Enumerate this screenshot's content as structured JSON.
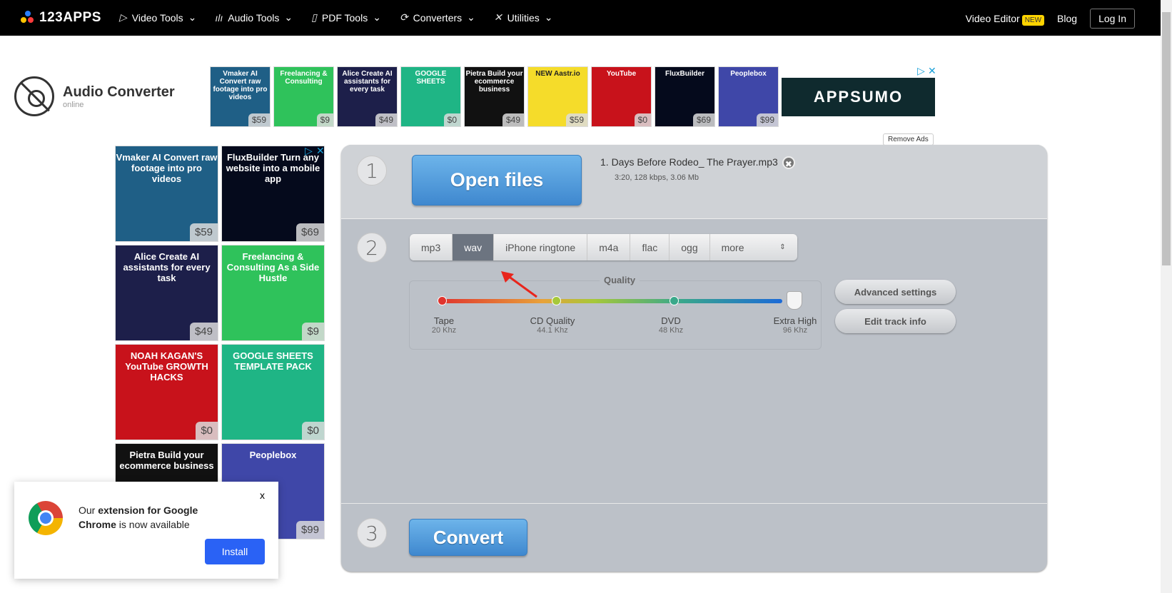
{
  "header": {
    "logo": "123APPS",
    "nav": [
      {
        "label": "Video Tools",
        "icon": "play-icon"
      },
      {
        "label": "Audio Tools",
        "icon": "waveform-icon"
      },
      {
        "label": "PDF Tools",
        "icon": "document-icon"
      },
      {
        "label": "Converters",
        "icon": "refresh-icon"
      },
      {
        "label": "Utilities",
        "icon": "tools-icon"
      }
    ],
    "video_editor": "Video Editor",
    "new_badge": "NEW",
    "blog": "Blog",
    "login": "Log In"
  },
  "brand": {
    "title": "Audio Converter",
    "subtitle": "online"
  },
  "top_ads": [
    {
      "text": "Vmaker AI Convert raw footage into pro videos",
      "price": "$59",
      "color": "#1f5f86"
    },
    {
      "text": "Freelancing & Consulting",
      "price": "$9",
      "color": "#2fc25b"
    },
    {
      "text": "Alice Create AI assistants for every task",
      "price": "$49",
      "color": "#1d1f4a"
    },
    {
      "text": "GOOGLE SHEETS",
      "price": "$0",
      "color": "#1fb585"
    },
    {
      "text": "Pietra Build your ecommerce business",
      "price": "$49",
      "color": "#111"
    },
    {
      "text": "NEW Aastr.io",
      "price": "$59",
      "color": "#f5dc2a"
    },
    {
      "text": "YouTube",
      "price": "$0",
      "color": "#c8121b"
    },
    {
      "text": "FluxBuilder",
      "price": "$69",
      "color": "#050a1c"
    },
    {
      "text": "Peoplebox",
      "price": "$99",
      "color": "#3f47a8"
    }
  ],
  "side_ads": [
    {
      "text": "Vmaker AI Convert raw footage into pro videos",
      "price": "$59",
      "color": "#1f5f86"
    },
    {
      "text": "FluxBuilder Turn any website into a mobile app",
      "price": "$69",
      "color": "#050a1c"
    },
    {
      "text": "Alice Create AI assistants for every task",
      "price": "$49",
      "color": "#1d1f4a"
    },
    {
      "text": "Freelancing & Consulting As a Side Hustle",
      "price": "$9",
      "color": "#2fc25b"
    },
    {
      "text": "NOAH KAGAN'S YouTube GROWTH HACKS",
      "price": "$0",
      "color": "#c8121b"
    },
    {
      "text": "GOOGLE SHEETS TEMPLATE PACK",
      "price": "$0",
      "color": "#1fb585"
    },
    {
      "text": "Pietra Build your ecommerce business",
      "price": "",
      "color": "#111"
    },
    {
      "text": "Peoplebox",
      "price": "$99",
      "color": "#3f47a8"
    }
  ],
  "appsumo": "APPSUMO",
  "remove_ads": "Remove Ads",
  "steps": {
    "one": "1",
    "two": "2",
    "three": "3"
  },
  "open_files": "Open files",
  "file": {
    "name": "1. Days Before Rodeo_ The Prayer.mp3",
    "meta": "3:20, 128 kbps, 3.06 Mb"
  },
  "formats": [
    "mp3",
    "wav",
    "iPhone ringtone",
    "m4a",
    "flac",
    "ogg"
  ],
  "more": "more",
  "selected_format": "wav",
  "quality": {
    "label": "Quality",
    "selected": "Extra High",
    "levels": [
      {
        "name": "Tape",
        "rate": "20 Khz"
      },
      {
        "name": "CD Quality",
        "rate": "44.1 Khz"
      },
      {
        "name": "DVD",
        "rate": "48 Khz"
      },
      {
        "name": "Extra High",
        "rate": "96 Khz"
      }
    ]
  },
  "advanced_settings": "Advanced settings",
  "edit_track_info": "Edit track info",
  "convert": "Convert",
  "popup": {
    "prefix": "Our ",
    "bold1": "extension for Google Chrome",
    "suffix": " is now available",
    "install": "Install",
    "close": "x"
  }
}
